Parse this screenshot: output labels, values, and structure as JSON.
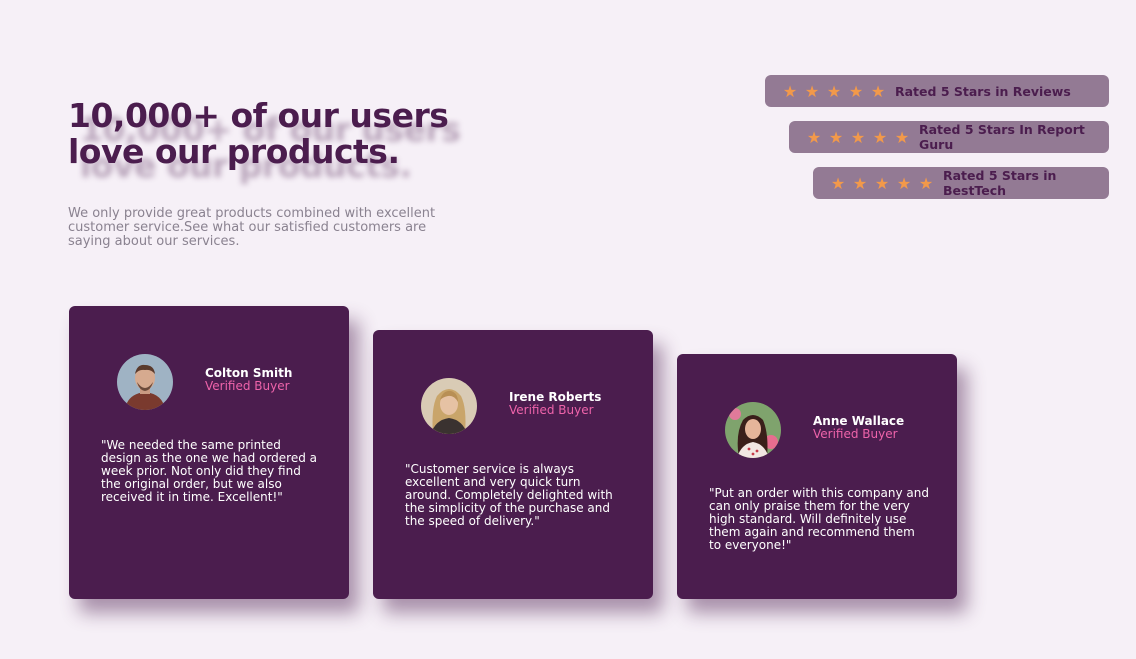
{
  "heading": {
    "line1": "10,000+ of our users",
    "line2": "love our products."
  },
  "intro": "We only provide great products combined with excellent customer service.See what our satisfied customers are saying about our services.",
  "star_color": "#f2994a",
  "ratings": [
    {
      "stars": 5,
      "label": "Rated 5 Stars in Reviews"
    },
    {
      "stars": 5,
      "label": "Rated 5 Stars In Report Guru"
    },
    {
      "stars": 5,
      "label": "Rated 5 Stars in BestTech"
    }
  ],
  "testimonials": [
    {
      "name": "Colton Smith",
      "role": "Verified Buyer",
      "quote": "\"We needed the same printed design as the one we had ordered a week prior. Not only did they find the original order, but we also received it in time. Excellent!\""
    },
    {
      "name": "Irene Roberts",
      "role": "Verified Buyer",
      "quote": "\"Customer service is always excellent and very quick turn around. Completely delighted with the simplicity of the purchase and the speed of delivery.\""
    },
    {
      "name": "Anne Wallace",
      "role": "Verified Buyer",
      "quote": "\"Put an order with this company and can only praise them for the very high standard. Will definitely use them again and recommend them to everyone!\""
    }
  ],
  "colors": {
    "background": "#f6f0f7",
    "brand_purple": "#4b1d4e",
    "rating_bg": "#937a94",
    "accent_pink": "#ee63aa",
    "muted_text": "#8a8290"
  }
}
